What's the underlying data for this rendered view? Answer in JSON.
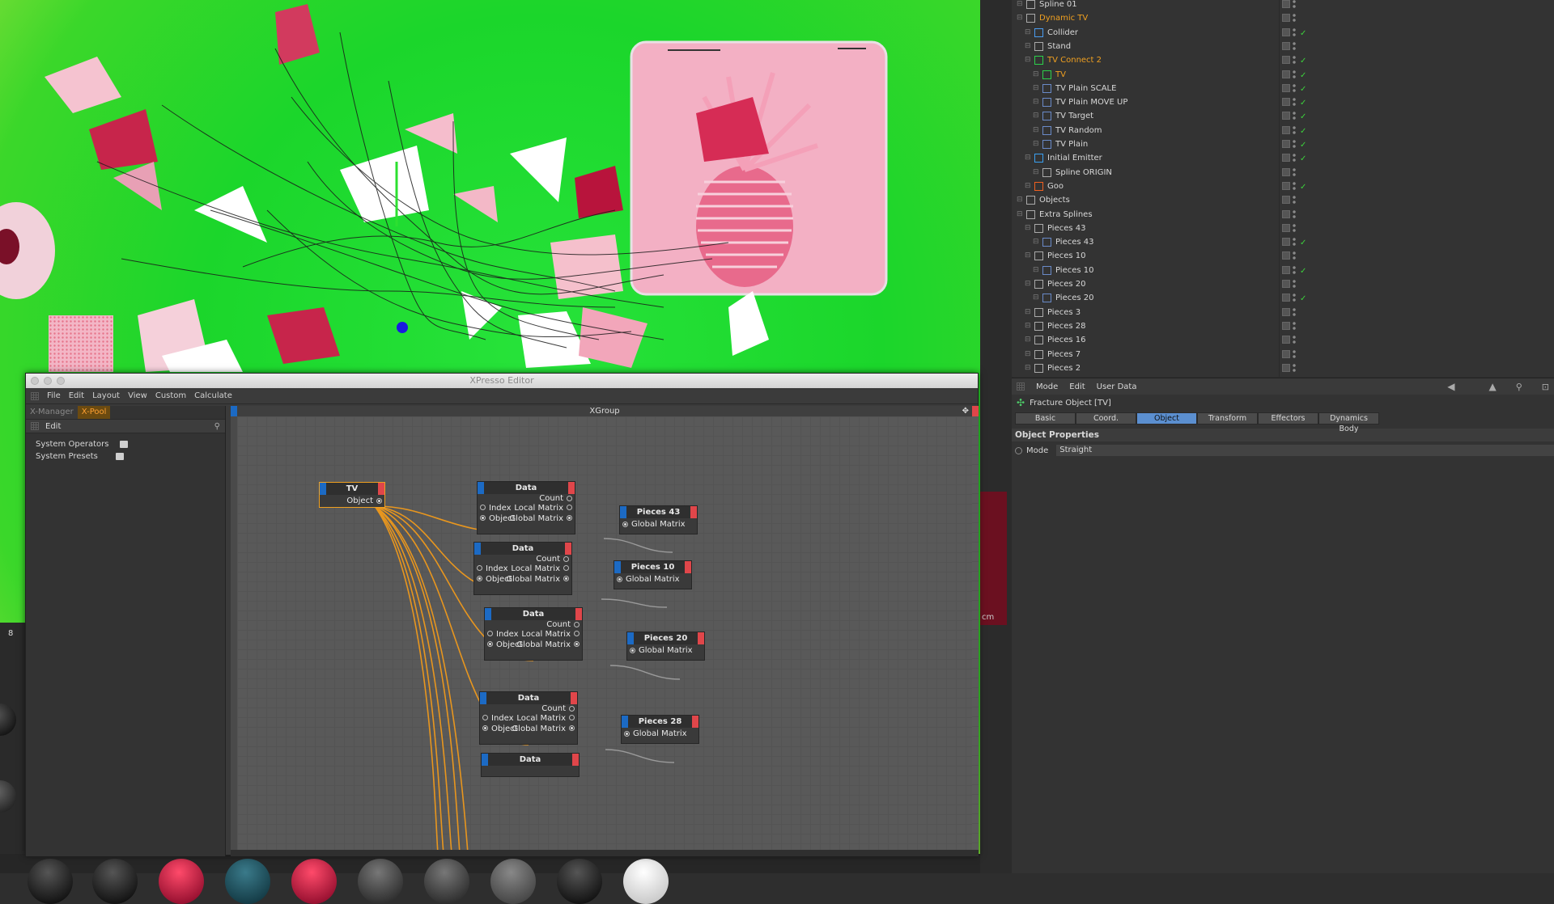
{
  "viewport": {
    "frame_number": "8",
    "unit_label": "cm"
  },
  "xpresso": {
    "window_title": "XPresso Editor",
    "menu": [
      "File",
      "Edit",
      "Layout",
      "View",
      "Custom",
      "Calculate"
    ],
    "tabs": [
      "X-Manager",
      "X-Pool"
    ],
    "active_tab": "X-Pool",
    "left_edit_label": "Edit",
    "pool_items": [
      "System Operators",
      "System Presets"
    ],
    "group_title": "XGroup",
    "tv_node": {
      "title": "TV",
      "port": "Object"
    },
    "data_nodes": [
      {
        "title": "Data",
        "in1": "Index",
        "in2": "Object",
        "out1": "Count",
        "out2": "Local Matrix",
        "out3": "Global Matrix"
      },
      {
        "title": "Data",
        "in1": "Index",
        "in2": "Object",
        "out1": "Count",
        "out2": "Local Matrix",
        "out3": "Global Matrix"
      },
      {
        "title": "Data",
        "in1": "Index",
        "in2": "Object",
        "out1": "Count",
        "out2": "Local Matrix",
        "out3": "Global Matrix"
      },
      {
        "title": "Data",
        "in1": "Index",
        "in2": "Object",
        "out1": "Count",
        "out2": "Local Matrix",
        "out3": "Global Matrix"
      },
      {
        "title": "Data"
      }
    ],
    "target_nodes": [
      {
        "title": "Pieces 43",
        "port": "Global Matrix"
      },
      {
        "title": "Pieces 10",
        "port": "Global Matrix"
      },
      {
        "title": "Pieces 20",
        "port": "Global Matrix"
      },
      {
        "title": "Pieces 28",
        "port": "Global Matrix"
      }
    ]
  },
  "object_manager": {
    "rows": [
      "Spline 01",
      "Dynamic TV",
      "Collider",
      "Stand",
      "TV Connect 2",
      "TV",
      "TV Plain SCALE",
      "TV Plain MOVE UP",
      "TV Target",
      "TV Random",
      "TV Plain",
      "Initial Emitter",
      "Spline ORIGIN",
      "Goo",
      "Objects",
      "Extra Splines",
      "Pieces 43",
      "Pieces 43",
      "Pieces 10",
      "Pieces 10",
      "Pieces 20",
      "Pieces 20",
      "Pieces 3",
      "Pieces 28",
      "Pieces 16",
      "Pieces 7",
      "Pieces 2"
    ]
  },
  "attribute_manager": {
    "menu": [
      "Mode",
      "Edit",
      "User Data"
    ],
    "object_title": "Fracture Object [TV]",
    "tabs": [
      "Basic",
      "Coord.",
      "Object",
      "Transform",
      "Effectors",
      "Dynamics Body"
    ],
    "active_tab": "Object",
    "section_title": "Object Properties",
    "mode_label": "Mode",
    "mode_value": "Straight"
  },
  "colors": {
    "accent_orange": "#f0a020",
    "selection_blue": "#5b8fd0",
    "port_blue": "#1c6ac4",
    "port_red": "#e0464a",
    "viewport_green": "#1bd62b"
  }
}
